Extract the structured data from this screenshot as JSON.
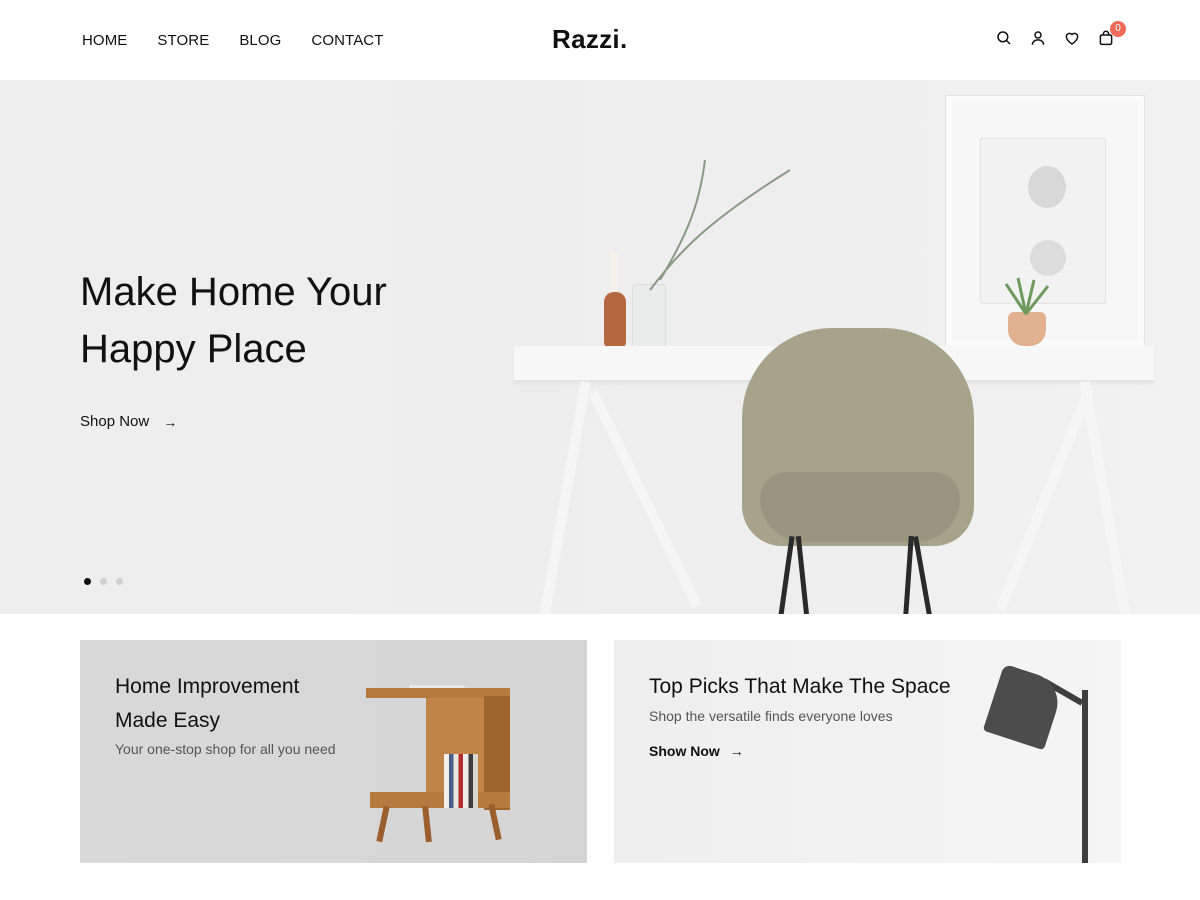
{
  "header": {
    "nav": [
      "HOME",
      "STORE",
      "BLOG",
      "CONTACT"
    ],
    "logo": "Razzi.",
    "icons": [
      "search-icon",
      "user-icon",
      "heart-icon",
      "bag-icon"
    ],
    "cart_count": "0",
    "badge_color": "#ef6a58"
  },
  "hero": {
    "title_line1": "Make Home Your",
    "title_line2": "Happy Place",
    "cta_label": "Shop Now",
    "cta_arrow": "→",
    "slides": 3,
    "active_slide": 1
  },
  "banners": [
    {
      "title_line1": "Home Improvement",
      "title_line2": "Made Easy",
      "subtitle": "Your one-stop shop for all you need"
    },
    {
      "title_line1": "Top Picks That Make The Space",
      "subtitle": "Shop the versatile finds everyone loves",
      "cta_label": "Show Now",
      "cta_arrow": "→"
    }
  ]
}
